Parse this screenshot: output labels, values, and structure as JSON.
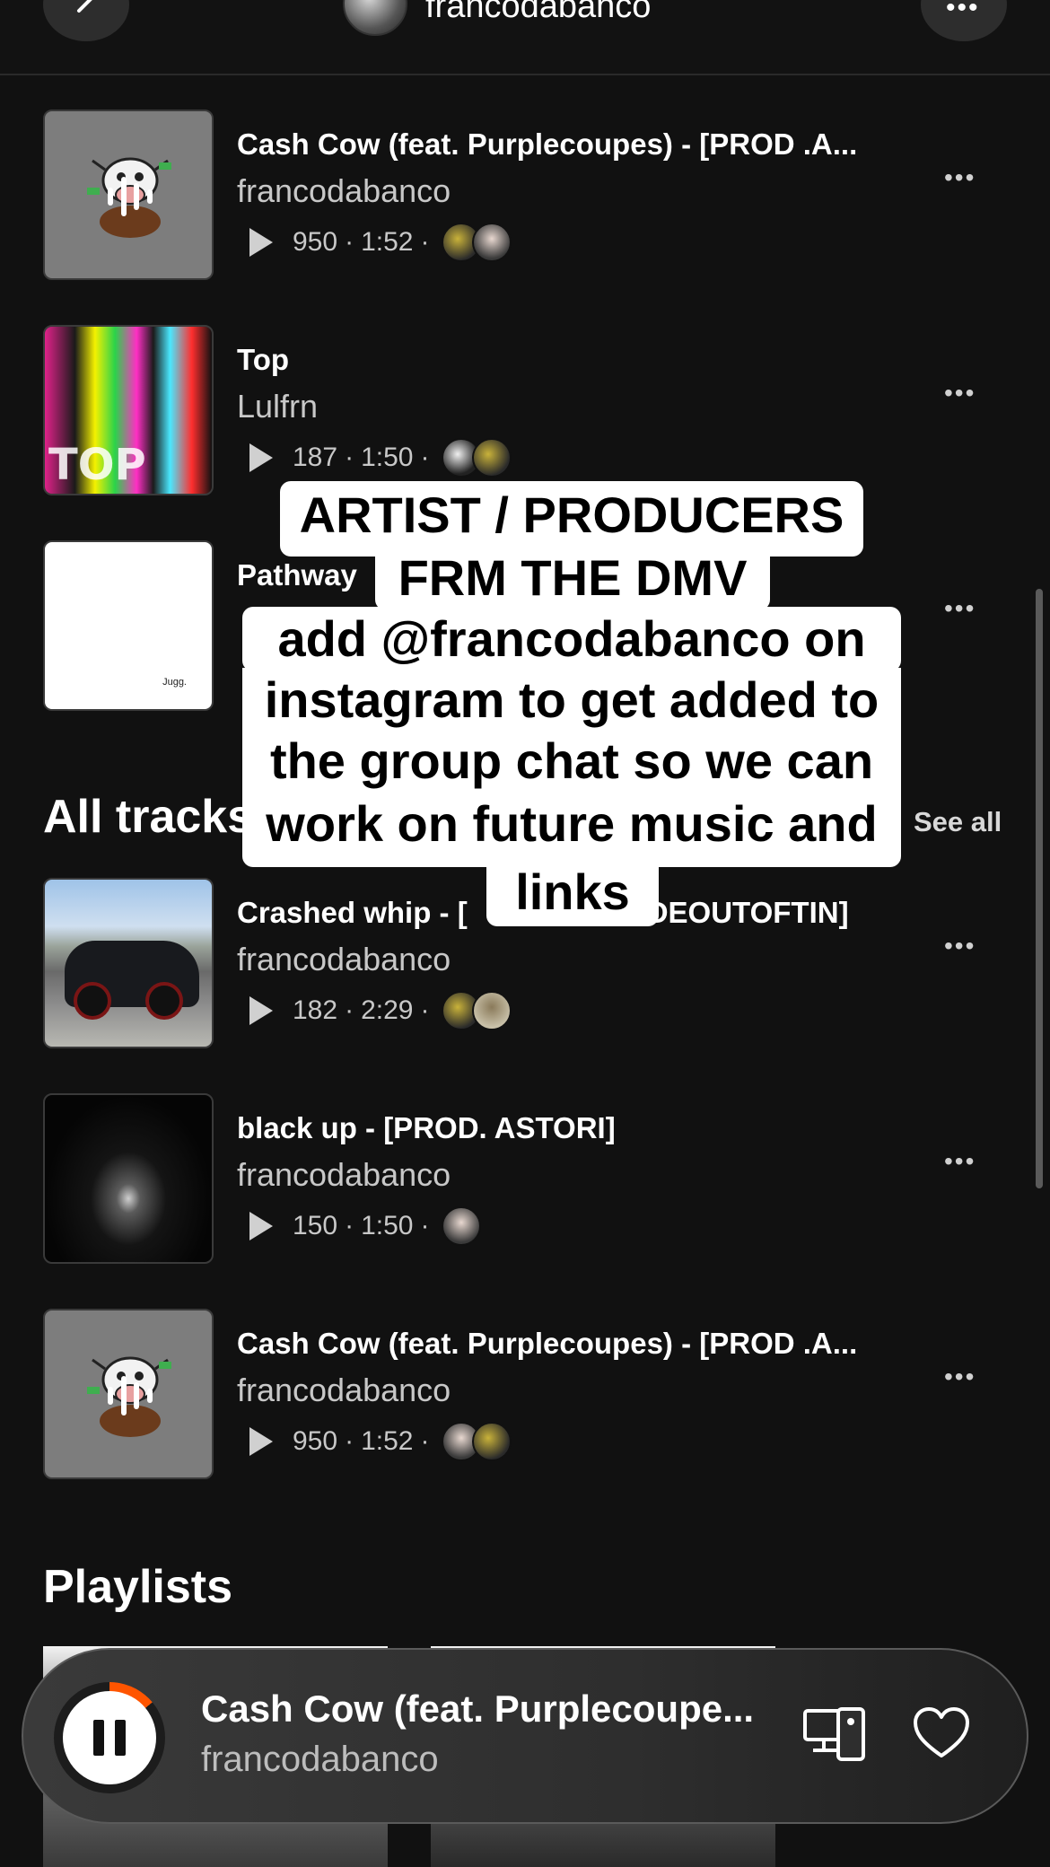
{
  "header": {
    "title": "francodabanco",
    "back_icon": "chevron-left-icon",
    "more_icon": "more-horizontal-icon",
    "more_label": "•••"
  },
  "popular_tracks": [
    {
      "title": "Cash Cow (feat. Purplecoupes)  -  [PROD .A...",
      "artist": "francodabanco",
      "plays": "950",
      "duration": "1:52",
      "cover": "cartoon-cow"
    },
    {
      "title": "Top",
      "artist": "Lulfrn",
      "plays": "187",
      "duration": "1:50",
      "cover": "colorful-top",
      "cover_text": "TOP"
    },
    {
      "title": "Pathway",
      "artist": "",
      "plays": "",
      "duration": "",
      "cover": "white",
      "cover_text": "Jugg."
    }
  ],
  "all_tracks": {
    "heading": "All tracks",
    "see_all": "See all",
    "items": [
      {
        "title": "Crashed whip  -  [",
        "title_tail": "DEOUTOFTIN]",
        "artist": "francodabanco",
        "plays": "182",
        "duration": "2:29",
        "cover": "crashed-car"
      },
      {
        "title": "black up  -  [PROD. ASTORI]",
        "artist": "francodabanco",
        "plays": "150",
        "duration": "1:50",
        "cover": "moonlit-sea"
      },
      {
        "title": "Cash Cow (feat. Purplecoupes)  -  [PROD .A...",
        "artist": "francodabanco",
        "plays": "950",
        "duration": "1:52",
        "cover": "cartoon-cow"
      }
    ]
  },
  "meta_separator": "·",
  "row_more_label": "•••",
  "playlists": {
    "heading": "Playlists"
  },
  "overlay_caption": {
    "lines": [
      "ARTIST / PRODUCERS",
      "FRM THE DMV",
      "add @francodabanco on",
      "instagram to get added to",
      "the group chat so we can",
      "work on future music and",
      "links"
    ]
  },
  "now_playing": {
    "title": "Cash Cow (feat. Purplecoupe...",
    "artist": "francodabanco",
    "state": "playing",
    "progress": 0.14,
    "pause_icon": "pause-icon",
    "device_icon": "devices-icon",
    "like_icon": "heart-icon"
  },
  "colors": {
    "background": "#111111",
    "accent": "#ff5500",
    "caption_bg": "#ffffff",
    "secondary_text": "#c8c8c8"
  }
}
